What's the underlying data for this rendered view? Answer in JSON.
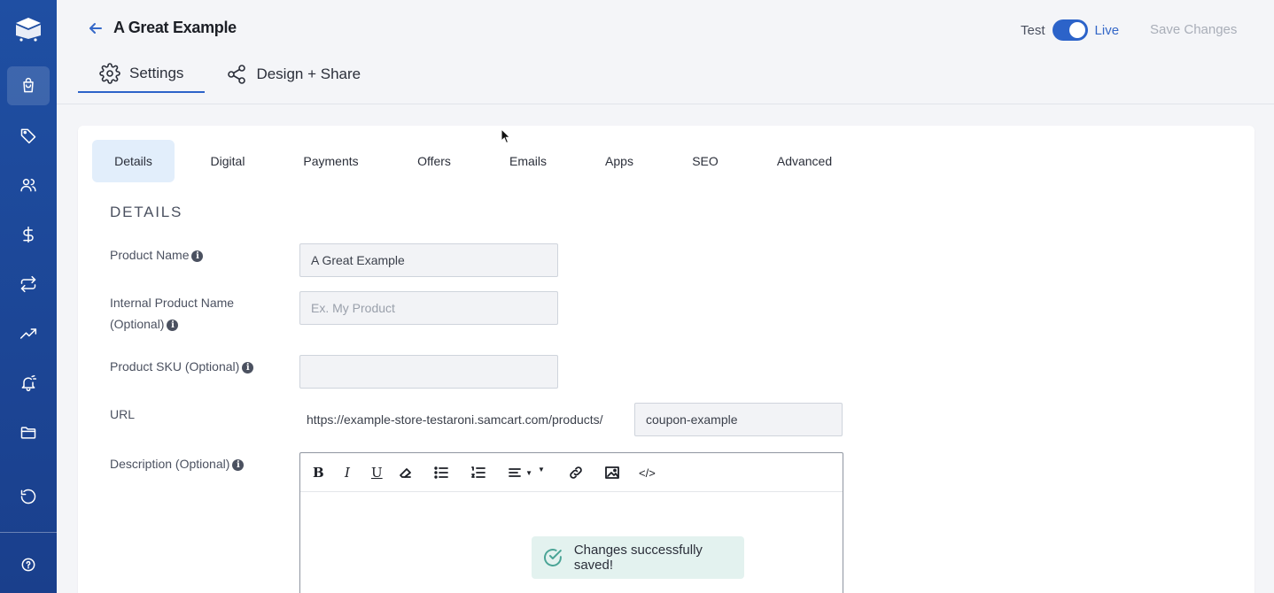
{
  "header": {
    "title": "A Great Example",
    "mode_test": "Test",
    "mode_live": "Live",
    "live_enabled": true,
    "save_label": "Save Changes"
  },
  "top_tabs": [
    {
      "label": "Settings",
      "icon": "gear-icon",
      "active": true
    },
    {
      "label": "Design + Share",
      "icon": "share-icon",
      "active": false
    }
  ],
  "sub_tabs": [
    {
      "label": "Details",
      "active": true
    },
    {
      "label": "Digital",
      "active": false
    },
    {
      "label": "Payments",
      "active": false
    },
    {
      "label": "Offers",
      "active": false
    },
    {
      "label": "Emails",
      "active": false
    },
    {
      "label": "Apps",
      "active": false
    },
    {
      "label": "SEO",
      "active": false
    },
    {
      "label": "Advanced",
      "active": false
    }
  ],
  "details": {
    "section_title": "DETAILS",
    "product_name_label": "Product Name",
    "product_name_value": "A Great Example",
    "internal_name_label_line1": "Internal Product Name",
    "internal_name_label_line2": "(Optional)",
    "internal_name_placeholder": "Ex. My Product",
    "sku_label": "Product SKU (Optional)",
    "sku_value": "",
    "url_label": "URL",
    "url_prefix": "https://example-store-testaroni.samcart.com/products/",
    "url_slug": "coupon-example",
    "description_label": "Description (Optional)"
  },
  "editor_toolbar": [
    "bold-icon",
    "italic-icon",
    "underline-icon",
    "eraser-icon",
    "bullet-list-icon",
    "numbered-list-icon",
    "align-icon",
    "link-icon",
    "image-icon",
    "code-icon"
  ],
  "toast": {
    "message": "Changes successfully saved!"
  },
  "sidebar": {
    "items": [
      "cart-icon",
      "tag-icon",
      "users-icon",
      "dollar-icon",
      "repeat-icon",
      "trending-icon",
      "bell-icon",
      "folder-icon",
      "history-icon",
      "help-icon"
    ],
    "active": "cart-icon"
  },
  "colors": {
    "sidebar": "#1f4fa3",
    "accent": "#2c63c9",
    "active_subtab": "#e2eefb",
    "toast_bg": "#e3f2ef",
    "toast_icon": "#4aa496"
  }
}
